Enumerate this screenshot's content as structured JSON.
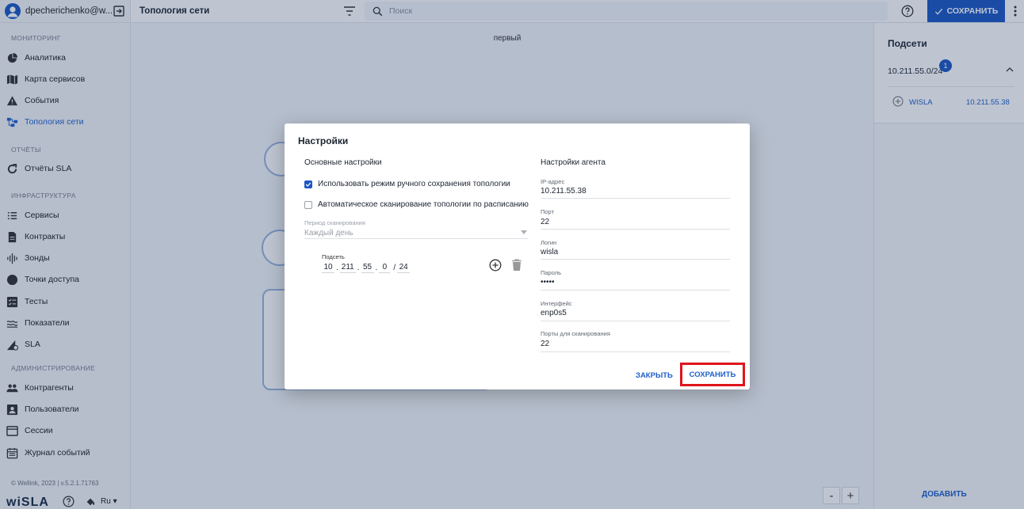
{
  "user": {
    "name": "dpecherichenko@w..."
  },
  "nav": {
    "sections": {
      "monitoring": "МОНИТОРИНГ",
      "reports": "ОТЧЁТЫ",
      "infrastructure": "ИНФРАСТРУКТУРА",
      "administration": "АДМИНИСТРИРОВАНИЕ"
    },
    "items": {
      "analytics": "Аналитика",
      "service_map": "Карта сервисов",
      "events": "События",
      "topology": "Топология сети",
      "sla_reports": "Отчёты SLA",
      "services": "Сервисы",
      "contracts": "Контракты",
      "probes": "Зонды",
      "access_points": "Точки доступа",
      "tests": "Тесты",
      "metrics": "Показатели",
      "sla": "SLA",
      "counterparties": "Контрагенты",
      "users": "Пользователи",
      "sessions": "Сессии",
      "event_log": "Журнал событий"
    }
  },
  "footer": {
    "copyright": "© Wellink, 2023 | v.5.2.1.71763",
    "logo": "wiSLA",
    "lang": "Ru"
  },
  "topbar": {
    "title": "Топология сети",
    "search_placeholder": "Поиск",
    "save_label": "СОХРАНИТЬ"
  },
  "canvas": {
    "label": "первый"
  },
  "zoom": {
    "out": "-",
    "in": "+"
  },
  "right_panel": {
    "title": "Подсети",
    "subnet": "10.211.55.0/24",
    "badge": "1",
    "agent_name": "WISLA",
    "agent_ip": "10.211.55.38",
    "add_label": "ДОБАВИТЬ"
  },
  "dialog": {
    "title": "Настройки",
    "basic_section": "Основные настройки",
    "agent_section": "Настройки агента",
    "manual_save": {
      "label": "Использовать режим ручного сохранения топологии",
      "checked": true
    },
    "auto_scan": {
      "label": "Автоматическое сканирование топологии по расписанию",
      "checked": false
    },
    "period": {
      "label": "Период сканирования",
      "value": "Каждый день"
    },
    "subnet": {
      "label": "Подсеть",
      "octets": [
        "10",
        "211",
        "55",
        "0"
      ],
      "mask": "24"
    },
    "agent_fields": [
      {
        "label": "IP-адрес",
        "value": "10.211.55.38"
      },
      {
        "label": "Порт",
        "value": "22"
      },
      {
        "label": "Логин",
        "value": "wisla"
      },
      {
        "label": "Пароль",
        "value": "•••••"
      },
      {
        "label": "Интерфейс",
        "value": "enp0s5"
      },
      {
        "label": "Порты для сканирования",
        "value": "22"
      }
    ],
    "close_label": "ЗАКРЫТЬ",
    "save_label": "СОХРАНИТЬ"
  },
  "colors": {
    "accent": "#1d58c4",
    "highlight": "#e0141c"
  }
}
